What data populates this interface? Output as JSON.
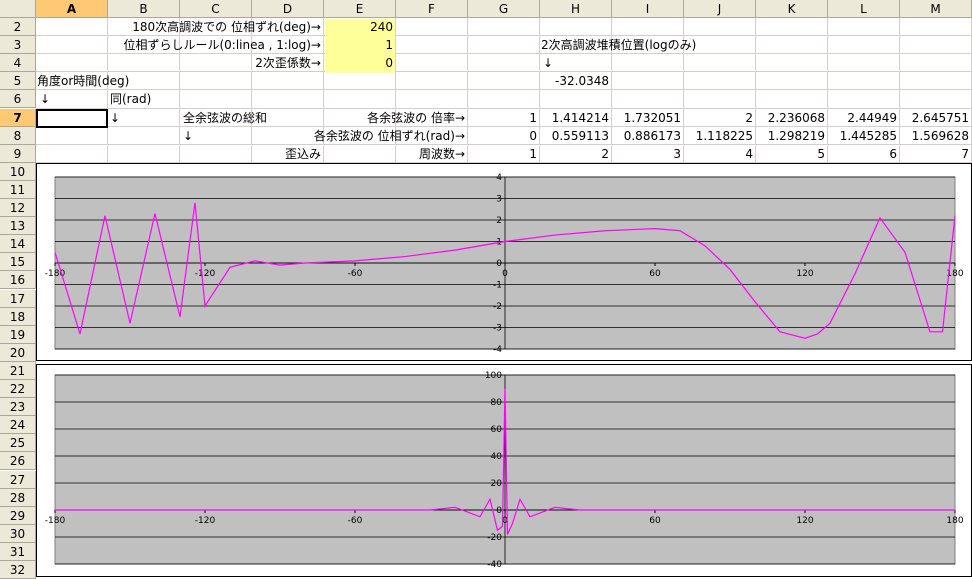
{
  "columns": [
    "A",
    "B",
    "C",
    "D",
    "E",
    "F",
    "G",
    "H",
    "I",
    "J",
    "K",
    "L",
    "M"
  ],
  "active_column": "A",
  "rows": [
    "2",
    "3",
    "4",
    "5",
    "6",
    "7",
    "8",
    "9",
    "10",
    "11",
    "12",
    "13",
    "14",
    "15",
    "16",
    "17",
    "18",
    "19",
    "20",
    "21",
    "22",
    "23",
    "24",
    "25",
    "26",
    "27",
    "28",
    "29",
    "30",
    "31",
    "32"
  ],
  "active_row": "7",
  "cells": {
    "d2": "180次高調波での 位相ずれ(deg)→",
    "e2": "240",
    "d3": "位相ずらしルール(0:linea , 1:log)→",
    "e3": "1",
    "d4": "2次歪係数→",
    "e4": "0",
    "h3": "2次高調波堆積位置(logのみ)",
    "h4": "↓",
    "h5": "-32.0348",
    "a5": "角度or時間(deg)",
    "a6": "↓",
    "b6": "同(rad)",
    "b7": "↓",
    "c7": "全余弦波の総和",
    "f7": "各余弦波の 倍率→",
    "f8": "各余弦波の 位相ずれ(rad)→",
    "c8": "↓",
    "d9": "歪込み",
    "f9": "周波数→"
  },
  "row7_values": [
    "1",
    "1.414214",
    "1.732051",
    "2",
    "2.236068",
    "2.44949",
    "2.645751"
  ],
  "row8_values": [
    "0",
    "0.559113",
    "0.886173",
    "1.118225",
    "1.298219",
    "1.445285",
    "1.569628"
  ],
  "row9_values": [
    "1",
    "2",
    "3",
    "4",
    "5",
    "6",
    "7"
  ],
  "colors": {
    "plot_bg": "#c0c0c0",
    "line": "#ff00ff",
    "input_bg": "#ffff99",
    "header_bg": "#ece9d8",
    "active_header": "#ffc875"
  },
  "chart_data": [
    {
      "type": "line",
      "x_ticks": [
        "-180",
        "-120",
        "-60",
        "0",
        "60",
        "120",
        "180"
      ],
      "y_ticks": [
        "4",
        "3",
        "2",
        "1",
        "0",
        "-1",
        "-2",
        "-3",
        "-4"
      ],
      "xlim": [
        -180,
        180
      ],
      "ylim": [
        -4,
        4
      ],
      "grid": true,
      "series": [
        {
          "x": [
            -180,
            -170,
            -160,
            -150,
            -140,
            -130,
            -124,
            -120,
            -110,
            -100,
            -90,
            -80,
            -60,
            -40,
            -20,
            0,
            20,
            40,
            60,
            70,
            80,
            90,
            100,
            110,
            120,
            125,
            130,
            140,
            150,
            160,
            170,
            175,
            180
          ],
          "y": [
            0.5,
            -3.3,
            2.2,
            -2.8,
            2.3,
            -2.5,
            2.8,
            -2.0,
            -0.2,
            0.1,
            -0.1,
            0,
            0.1,
            0.3,
            0.6,
            1.0,
            1.3,
            1.5,
            1.6,
            1.5,
            0.8,
            -0.3,
            -1.8,
            -3.2,
            -3.5,
            -3.3,
            -2.8,
            -0.5,
            2.1,
            0.5,
            -3.2,
            -3.2,
            2.2
          ]
        }
      ]
    },
    {
      "type": "line",
      "x_ticks": [
        "-180",
        "-120",
        "-60",
        "0",
        "60",
        "120",
        "180"
      ],
      "y_ticks": [
        "100",
        "80",
        "60",
        "40",
        "20",
        "0",
        "-20",
        "-40"
      ],
      "xlim": [
        -180,
        180
      ],
      "ylim": [
        -40,
        100
      ],
      "grid": true,
      "series": [
        {
          "x": [
            -180,
            -30,
            -20,
            -10,
            -6,
            -3,
            -1,
            0,
            1,
            3,
            6,
            10,
            20,
            30,
            180
          ],
          "y": [
            0,
            0,
            2,
            -5,
            8,
            -15,
            -12,
            90,
            -18,
            -10,
            8,
            -5,
            2,
            0,
            0
          ]
        }
      ]
    }
  ]
}
